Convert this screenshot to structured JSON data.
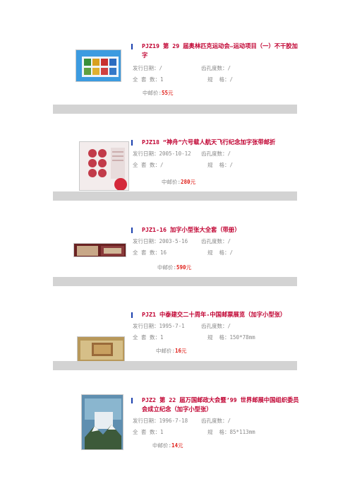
{
  "items": [
    {
      "title": "PJZ19 第 29 届奥林匹克运动会—运动项目（一）不干胶加字",
      "issue_label": "发行日期：",
      "issue_value": "/",
      "perf_label": "齿孔度数：",
      "perf_value": "/",
      "count_label": "全 套 数：",
      "count_value": "1",
      "size_label": "规  格：",
      "size_value": "/",
      "price_label": "中邮价:",
      "price_value": "55",
      "price_unit": "元"
    },
    {
      "title": "PJZ18 “神舟”六号载人航天飞行纪念加字张带邮折",
      "issue_label": "发行日期：",
      "issue_value": "2005-10-12",
      "perf_label": "齿孔度数：",
      "perf_value": "/",
      "count_label": "全 套 数：",
      "count_value": "/",
      "size_label": "规  格：",
      "size_value": "/",
      "price_label": "中邮价:",
      "price_value": "280",
      "price_unit": "元"
    },
    {
      "title": "PJZ1-16 加字小型张大全套（带册）",
      "issue_label": "发行日期：",
      "issue_value": "2003-5-16",
      "perf_label": "齿孔度数：",
      "perf_value": "/",
      "count_label": "全 套 数：",
      "count_value": "16",
      "size_label": "规  格：",
      "size_value": "/",
      "price_label": "中邮价:",
      "price_value": "590",
      "price_unit": "元"
    },
    {
      "title": "PJZ1 中泰建交二十周年-中国邮票展览（加字小型张）",
      "issue_label": "发行日期：",
      "issue_value": "1995-7-1",
      "perf_label": "齿孔度数：",
      "perf_value": "/",
      "count_label": "全 套 数：",
      "count_value": "1",
      "size_label": "规  格：",
      "size_value": "150*78mm",
      "price_label": "中邮价:",
      "price_value": "16",
      "price_unit": "元"
    },
    {
      "title": "PJZ2 第 22 届万国邮政大会暨’99 世界邮展中国组织委员会成立纪念（加字小型张）",
      "issue_label": "发行日期：",
      "issue_value": "1996-7-18",
      "perf_label": "齿孔度数：",
      "perf_value": "/",
      "count_label": "全 套 数：",
      "count_value": "1",
      "size_label": "规  格：",
      "size_value": "85*113mm",
      "price_label": "中邮价:",
      "price_value": "14",
      "price_unit": "元"
    }
  ]
}
